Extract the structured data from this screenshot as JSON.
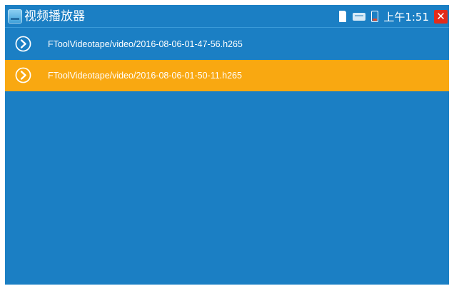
{
  "app": {
    "title": "视频播放器",
    "icon": "video-player-app-icon"
  },
  "status": {
    "time": "上午1:51",
    "icons": [
      "sd-card-icon",
      "lan-icon",
      "battery-icon"
    ],
    "close": "✕"
  },
  "files": [
    {
      "name": "FToolVideotape/video/2016-08-06-01-47-56.h265",
      "selected": false,
      "icon": "play-icon"
    },
    {
      "name": "FToolVideotape/video/2016-08-06-01-50-11.h265",
      "selected": true,
      "icon": "play-icon"
    }
  ],
  "colors": {
    "background": "#1b7fc4",
    "selected_row": "#f9a811",
    "close_button": "#e32b1a"
  }
}
